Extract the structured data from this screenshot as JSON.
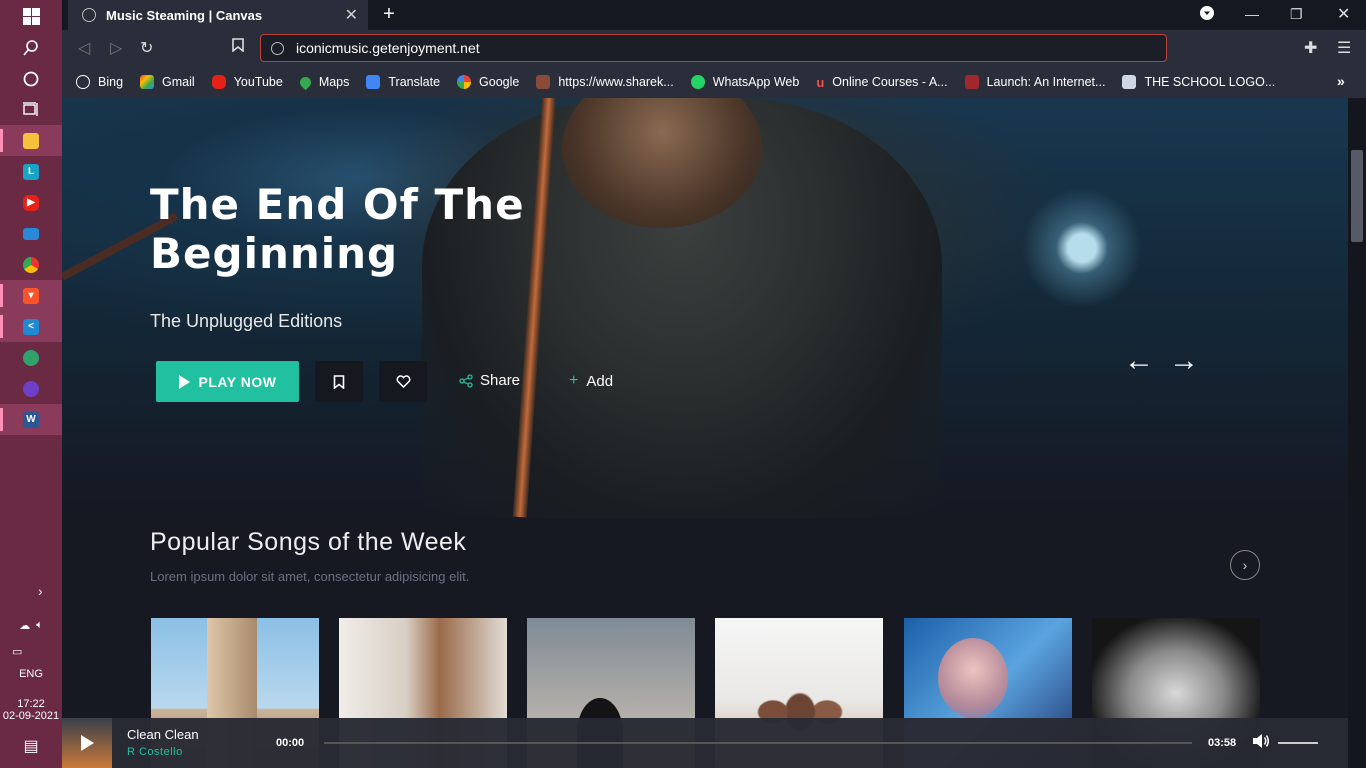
{
  "browser": {
    "tab_title": "Music Steaming | Canvas",
    "url": "iconicmusic.getenjoyment.net",
    "bookmarks": [
      "Bing",
      "Gmail",
      "YouTube",
      "Maps",
      "Translate",
      "Google",
      "https://www.sharek...",
      "WhatsApp Web",
      "Online Courses - A...",
      "Launch: An Internet...",
      "THE SCHOOL LOGO..."
    ]
  },
  "taskbar": {
    "lang": "ENG",
    "time": "17:22",
    "date": "02-09-2021"
  },
  "hero": {
    "title": "The End Of The Beginning",
    "subtitle": "The Unplugged Editions",
    "play_label": "PLAY NOW",
    "share_label": "Share",
    "add_label": "Add"
  },
  "popular": {
    "title": "Popular Songs of the Week",
    "subtitle": "Lorem ipsum dolor sit amet, consectetur adipisicing elit."
  },
  "player": {
    "title": "Clean Clean",
    "artist": "R Costello",
    "current_time": "00:00",
    "total_time": "03:58",
    "progress": 0
  },
  "colors": {
    "accent": "#20c0a0",
    "taskbar": "#6a2a43",
    "url_border": "#c0423f"
  }
}
